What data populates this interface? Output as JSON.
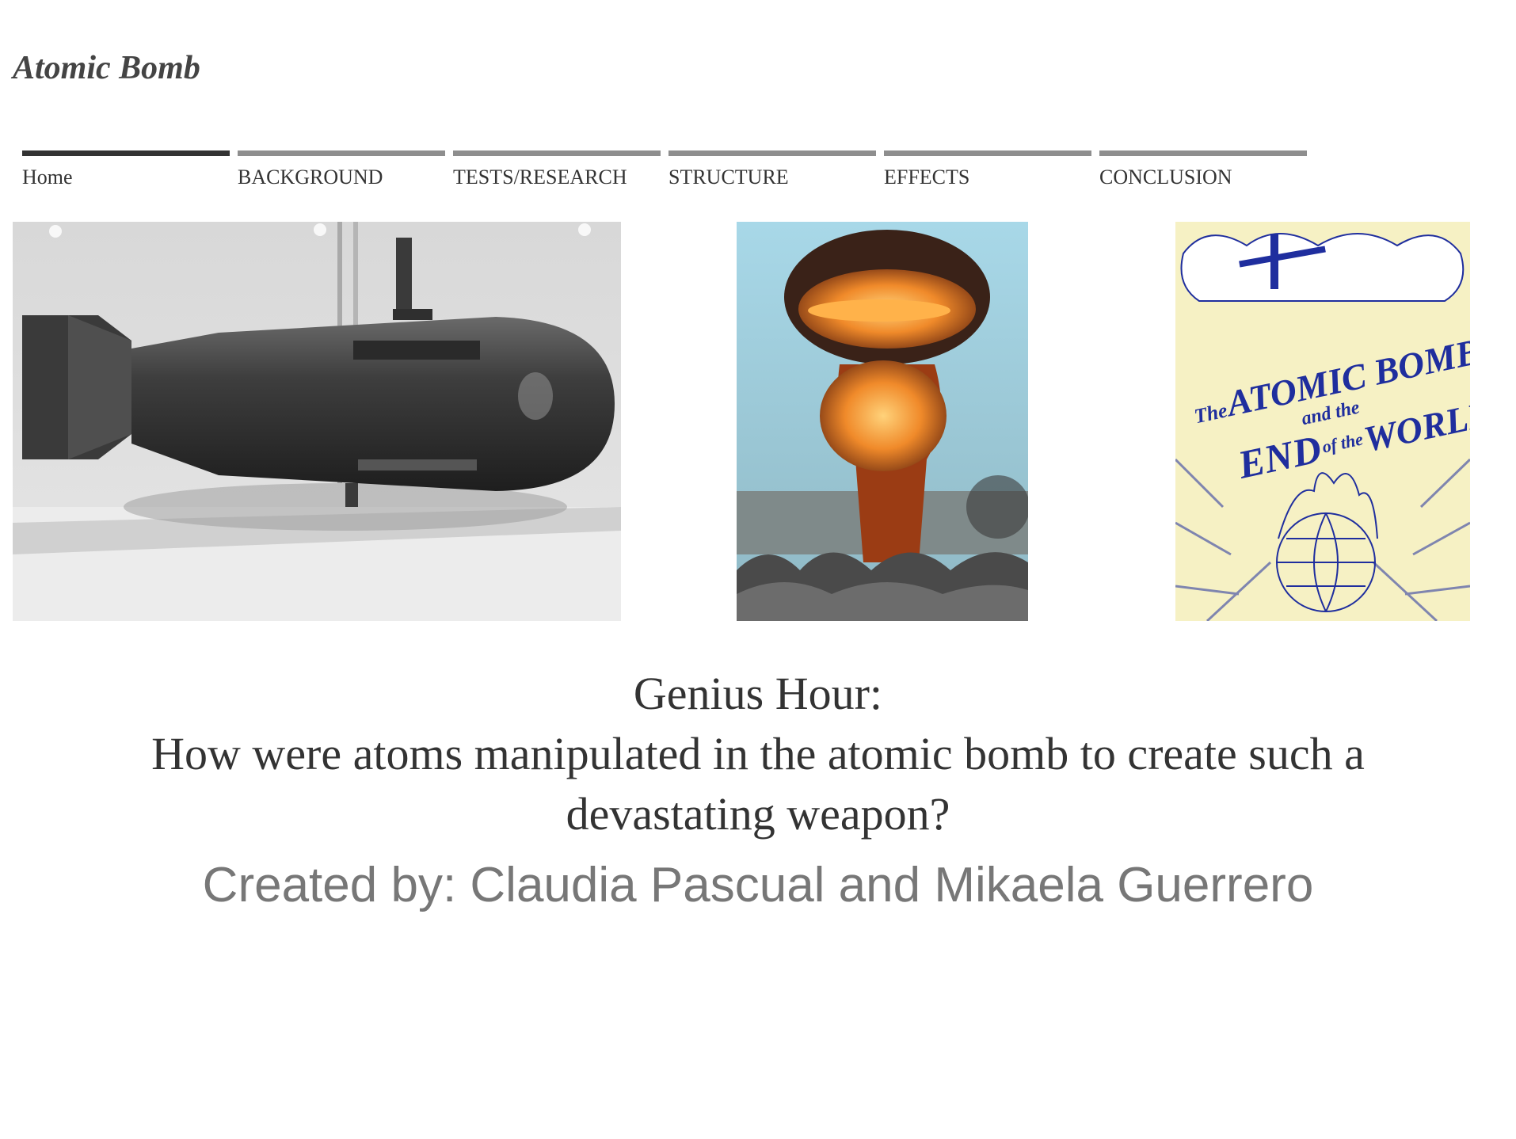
{
  "site": {
    "title": "Atomic Bomb"
  },
  "nav": {
    "items": [
      {
        "label": "Home",
        "active": true
      },
      {
        "label": "BACKGROUND",
        "active": false
      },
      {
        "label": "TESTS/RESEARCH",
        "active": false
      },
      {
        "label": "STRUCTURE",
        "active": false
      },
      {
        "label": "EFFECTS",
        "active": false
      },
      {
        "label": "CONCLUSION",
        "active": false
      }
    ]
  },
  "images": {
    "poster_text": [
      "The",
      "ATOMIC BOMB",
      "and the",
      "END",
      "of the",
      "WORLD"
    ]
  },
  "main": {
    "heading_line1": "Genius Hour:",
    "heading_line2": "How were atoms manipulated in the atomic bomb to create such a",
    "heading_line3": "devastating weapon?",
    "credit": "Created by: Claudia Pascual and Mikaela Guerrero"
  },
  "colors": {
    "nav_active": "#333333",
    "nav_inactive": "#8e8e8e",
    "credit_text": "#777777",
    "poster_blue": "#1f2e9e"
  }
}
